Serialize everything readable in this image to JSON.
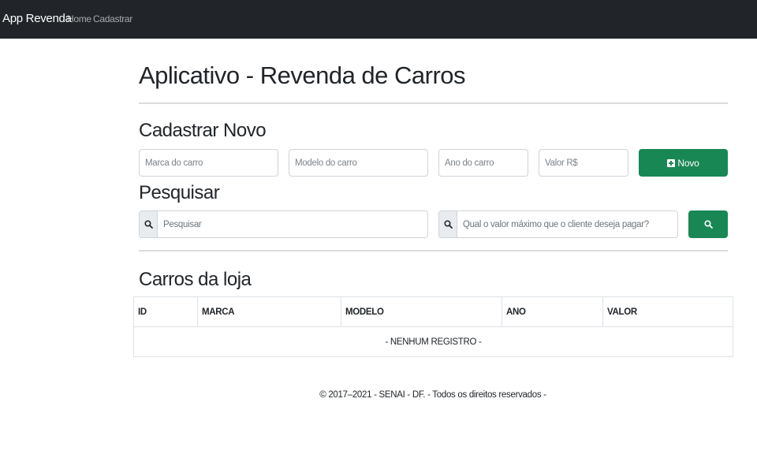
{
  "navbar": {
    "brand": "App Revenda",
    "links": [
      {
        "label": "Home"
      },
      {
        "label": "Cadastrar"
      }
    ]
  },
  "page": {
    "title": "Aplicativo - Revenda de Carros"
  },
  "cadastrar": {
    "heading": "Cadastrar Novo",
    "marca_placeholder": "Marca do carro",
    "modelo_placeholder": "Modelo do carro",
    "ano_placeholder": "Ano do carro",
    "valor_placeholder": "Valor R$",
    "novo_label": "Novo"
  },
  "pesquisar": {
    "heading": "Pesquisar",
    "search_placeholder": "Pesquisar",
    "max_value_placeholder": "Qual o valor máximo que o cliente deseja pagar?"
  },
  "carros": {
    "heading": "Carros da loja",
    "columns": [
      "ID",
      "MARCA",
      "MODELO",
      "ANO",
      "VALOR"
    ],
    "empty_message": "- NENHUM REGISTRO -"
  },
  "footer": {
    "text": "© 2017–2021 - SENAI - DF. - Todos os direitos reservados -"
  },
  "colors": {
    "navbar_bg": "#212529",
    "success": "#198754"
  },
  "icons": {
    "novo_button": "plus-square-icon",
    "search_addon": "search-icon",
    "search_button": "search-icon"
  }
}
